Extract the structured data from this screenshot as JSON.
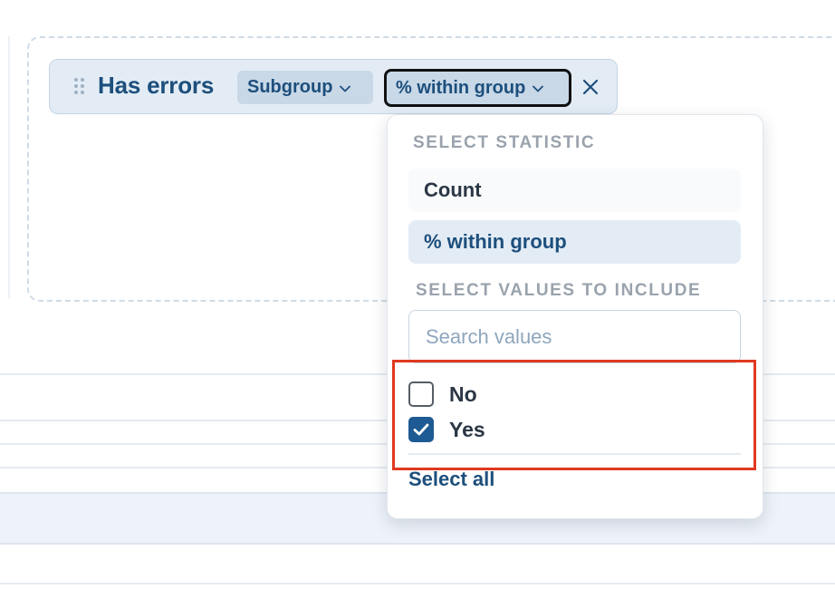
{
  "field_chip": {
    "title": "Has errors",
    "subgroup_label": "Subgroup",
    "statistic_label": "% within group",
    "remove_icon": "close-icon",
    "drag_icon": "drag-handle-icon"
  },
  "dropdown": {
    "statistic_section_label": "SELECT STATISTIC",
    "statistic_options": [
      {
        "label": "Count",
        "selected": false
      },
      {
        "label": "% within group",
        "selected": true
      }
    ],
    "values_section_label": "SELECT VALUES TO INCLUDE",
    "search": {
      "placeholder": "Search values",
      "value": ""
    },
    "values": [
      {
        "label": "No",
        "checked": false
      },
      {
        "label": "Yes",
        "checked": true
      }
    ],
    "select_all_label": "Select all"
  },
  "colors": {
    "accent": "#1d4f7c",
    "chip_background": "#e3ecf5",
    "pill_background": "#c8d8e7",
    "checkbox_checked": "#1e5a93",
    "highlight_box": "#e0391f",
    "section_label": "#9aa3ad"
  }
}
